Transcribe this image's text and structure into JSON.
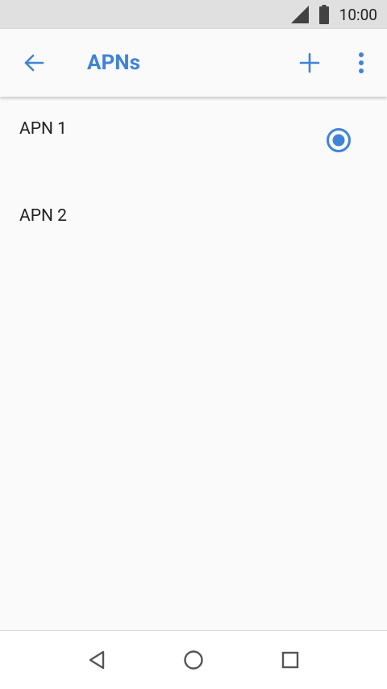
{
  "status_bar": {
    "time": "10:00",
    "icons": [
      "signal-icon",
      "battery-icon"
    ]
  },
  "app_bar": {
    "title": "APNs",
    "back_icon": "arrow-back-icon",
    "add_icon": "plus-icon",
    "more_icon": "more-vert-icon"
  },
  "apns": [
    {
      "label": "APN 1",
      "selected": true
    },
    {
      "label": "APN 2",
      "selected": false
    }
  ],
  "nav_bar": {
    "icons": [
      "back-triangle-icon",
      "home-circle-icon",
      "recents-square-icon"
    ]
  },
  "colors": {
    "accent": "#3f83d6",
    "status_bar": "#e0e0e0",
    "background": "#fafafa",
    "text": "#212121"
  }
}
